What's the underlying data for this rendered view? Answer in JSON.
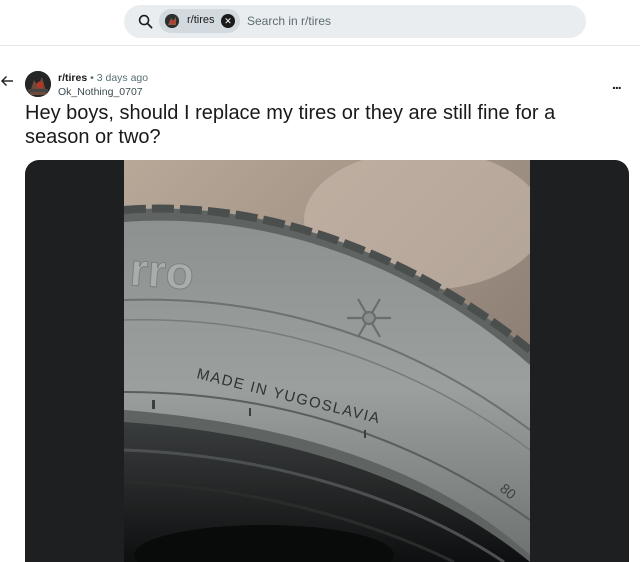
{
  "search": {
    "subreddit_chip": "r/tires",
    "placeholder": "Search in r/tires"
  },
  "post": {
    "subreddit": "r/tires",
    "separator": "•",
    "time_ago": "3 days ago",
    "author": "Ok_Nothing_0707",
    "more_label": "...",
    "title": "Hey boys, should I replace my tires or they are still fine for a season or two?",
    "image": {
      "sidewall_text_made_in": "MADE IN YUGOSLAVIA",
      "sidewall_text_brand": "rro",
      "sidewall_text_size": "80"
    }
  },
  "icons": {
    "search": "search-icon",
    "close": "close-icon",
    "back": "back-arrow-icon",
    "more": "more-options-icon",
    "snowflake": "snowflake-icon"
  }
}
